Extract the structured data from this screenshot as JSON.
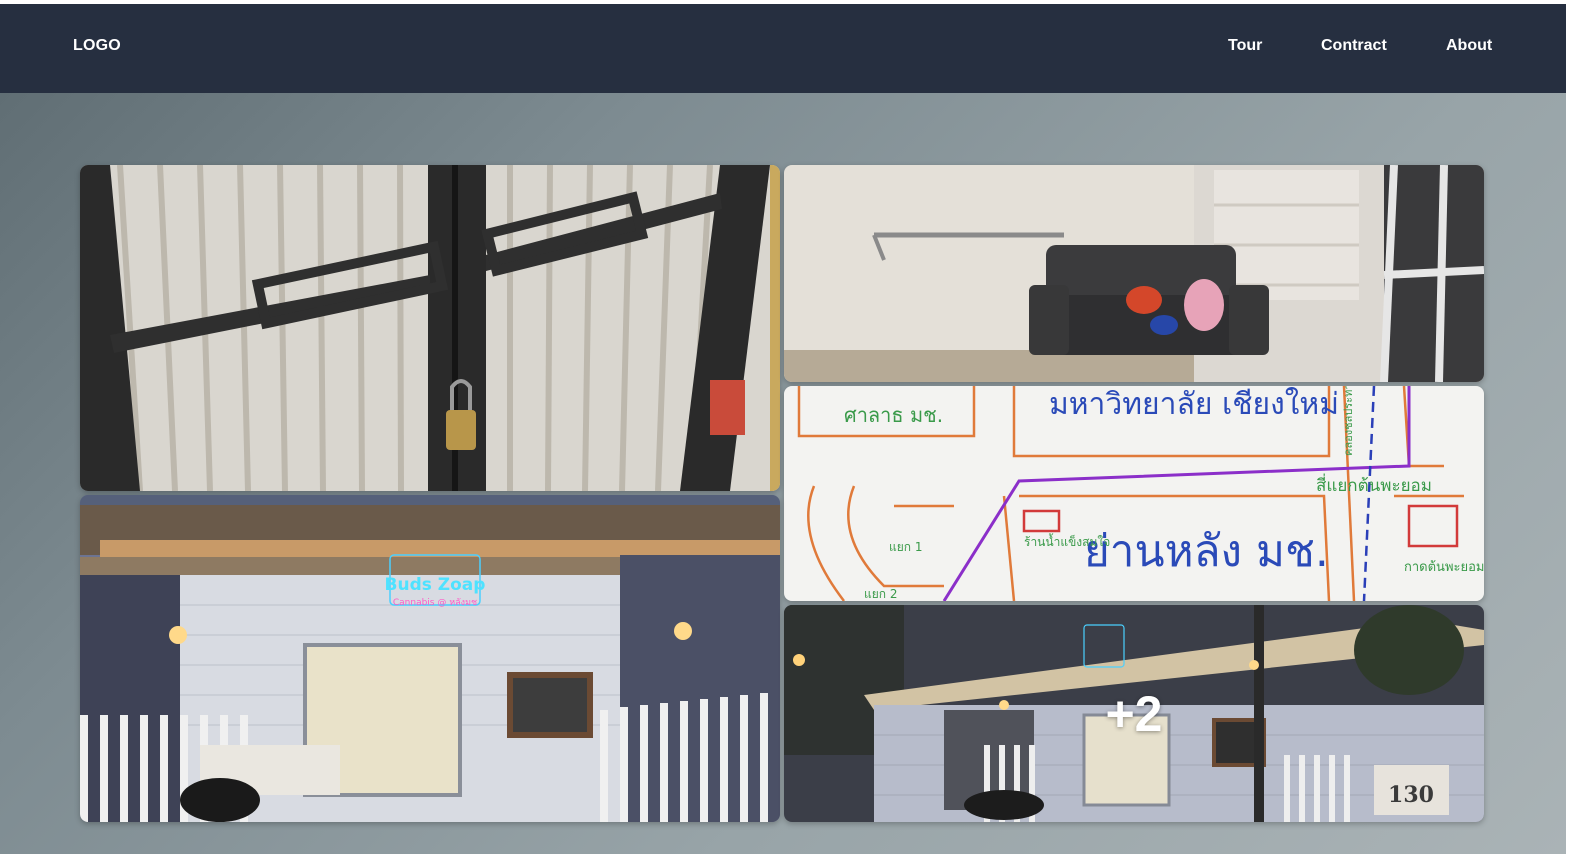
{
  "nav": {
    "logo": "LOGO",
    "links": [
      "Tour",
      "Contract",
      "About"
    ]
  },
  "gallery": {
    "photos": [
      {
        "icon": "photo-door-lock"
      },
      {
        "icon": "photo-interior-sofa"
      },
      {
        "icon": "photo-hand-drawn-map"
      },
      {
        "icon": "photo-shop-front"
      },
      {
        "icon": "photo-shop-street-night"
      }
    ],
    "shop_sign": "Buds Zoap",
    "shop_sign_sub": "Cannabis @ หลังมช",
    "map_labels": [
      "ศาลาธ มช.",
      "มหาวิทยาลัย เชียงใหม่",
      "ย่านหลัง มช.",
      "สี่แยกต้นพะยอม",
      "ร้านน้ำแข็งสมใจ",
      "กาดต้นพะยอม",
      "แยก 1",
      "แยก 2",
      "คลองชลประทาน"
    ],
    "house_number": "130",
    "more_count_label": "+2"
  }
}
